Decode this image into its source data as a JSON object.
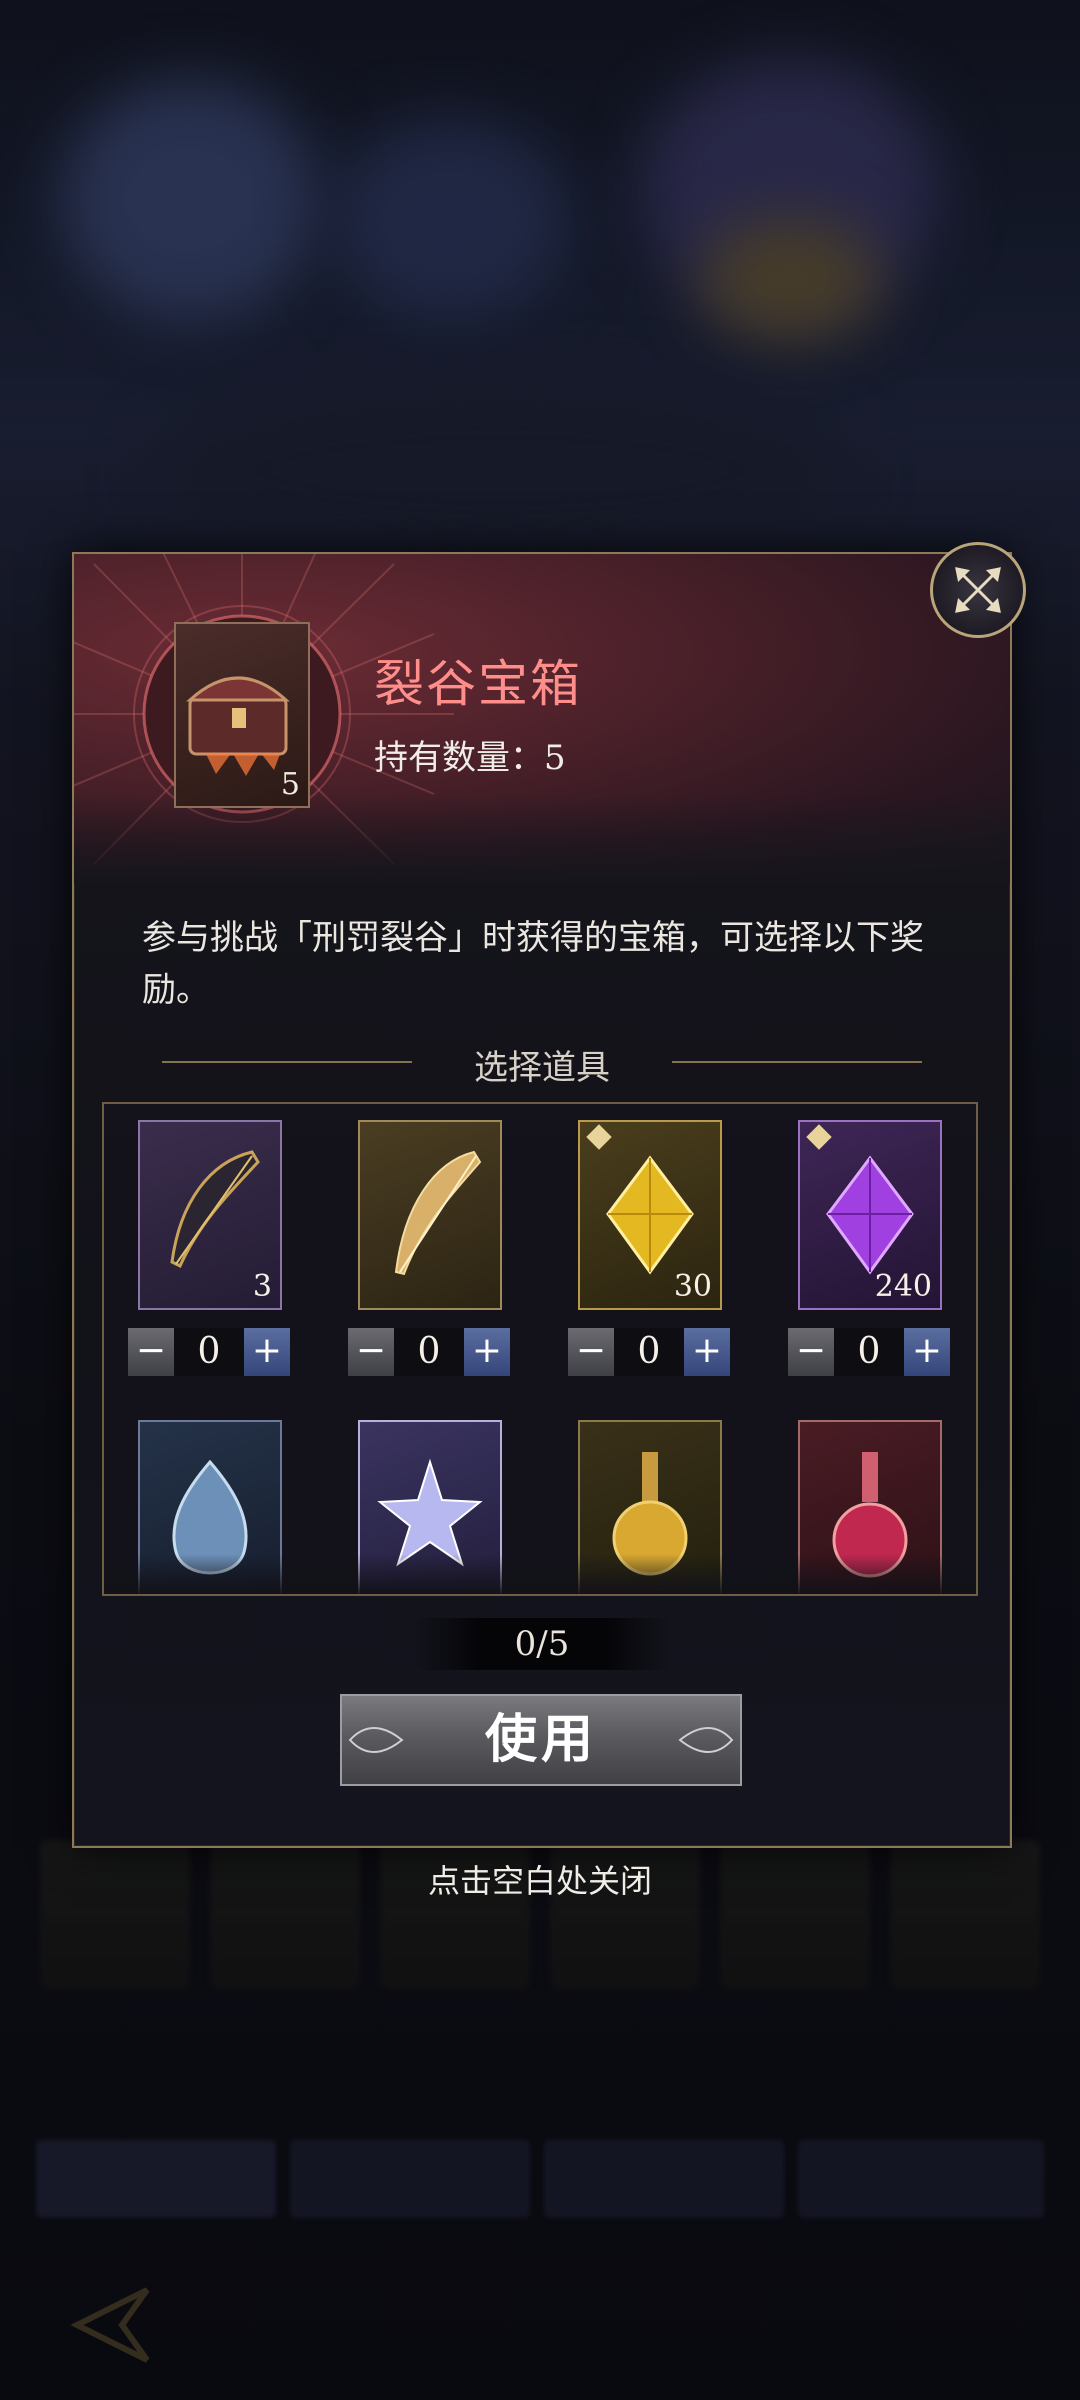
{
  "item": {
    "title": "裂谷宝箱",
    "owned_label": "持有数量：5",
    "icon_count": "5",
    "description": "参与挑战「刑罚裂谷」时获得的宝箱，可选择以下奖励。"
  },
  "section_title": "选择道具",
  "items": [
    {
      "name": "dark-feather",
      "qty": "3",
      "selected": "0"
    },
    {
      "name": "golden-feather",
      "qty": "",
      "selected": "0"
    },
    {
      "name": "gold-crystal",
      "qty": "30",
      "selected": "0"
    },
    {
      "name": "purple-crystal",
      "qty": "240",
      "selected": "0"
    },
    {
      "name": "blue-gem"
    },
    {
      "name": "star-crystal"
    },
    {
      "name": "gold-potion"
    },
    {
      "name": "red-potion"
    }
  ],
  "stepper": {
    "minus": "−",
    "plus": "+"
  },
  "selection_counter": "0/5",
  "use_button": "使用",
  "close_hint": "点击空白处关闭",
  "colors": {
    "title": "#ff8e8a",
    "gold_border": "#8a7a58",
    "plus_button": "#34457a"
  }
}
